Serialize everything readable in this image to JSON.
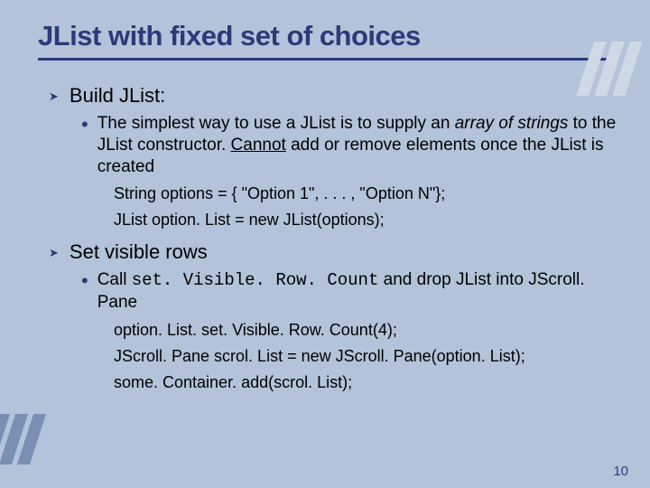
{
  "slide": {
    "title": "JList with fixed set of choices",
    "page_number": "10",
    "sections": [
      {
        "heading": "Build JList:",
        "bullets": [
          {
            "runs": [
              {
                "t": "The simplest way to use a JList is to supply an "
              },
              {
                "t": "array of strings",
                "italic": true
              },
              {
                "t": " to the JList constructor. "
              },
              {
                "t": "Cannot",
                "underline": true
              },
              {
                "t": " add or remove elements once the JList is created"
              }
            ]
          }
        ],
        "code": [
          "String options = { \"Option 1\", . . . , \"Option N\"};",
          "JList option. List = new JList(options);"
        ]
      },
      {
        "heading": "Set visible rows",
        "bullets": [
          {
            "runs": [
              {
                "t": "Call "
              },
              {
                "t": "set. Visible. Row. Count",
                "mono": true
              },
              {
                "t": " and drop JList into JScroll. Pane"
              }
            ]
          }
        ],
        "code": [
          "option. List. set. Visible. Row. Count(4);",
          "JScroll. Pane scrol. List = new JScroll. Pane(option. List);",
          "some. Container. add(scrol. List);"
        ]
      }
    ]
  }
}
